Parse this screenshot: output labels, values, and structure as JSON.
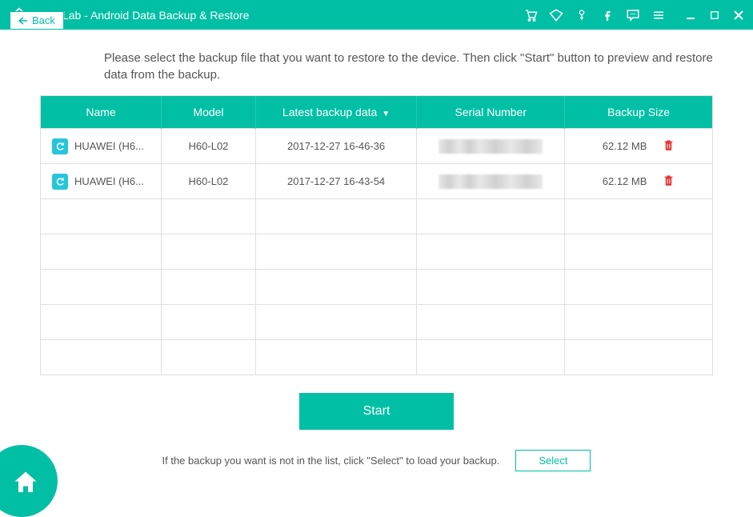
{
  "titlebar": {
    "title": "FoneLab - Android Data Backup & Restore"
  },
  "back": {
    "label": "Back"
  },
  "instruction": "Please select the backup file that you want to restore to the device. Then click \"Start\" button to preview and restore data from the backup.",
  "table": {
    "headers": {
      "name": "Name",
      "model": "Model",
      "latest": "Latest backup data",
      "serial": "Serial Number",
      "size": "Backup Size"
    },
    "rows": [
      {
        "name": "HUAWEI (H6...",
        "model": "H60-L02",
        "date": "2017-12-27 16-46-36",
        "size": "62.12 MB"
      },
      {
        "name": "HUAWEI (H6...",
        "model": "H60-L02",
        "date": "2017-12-27 16-43-54",
        "size": "62.12 MB"
      }
    ]
  },
  "start": {
    "label": "Start"
  },
  "footer": {
    "hint": "If the backup you want is not in the list, click \"Select\" to load your backup.",
    "select": "Select"
  }
}
